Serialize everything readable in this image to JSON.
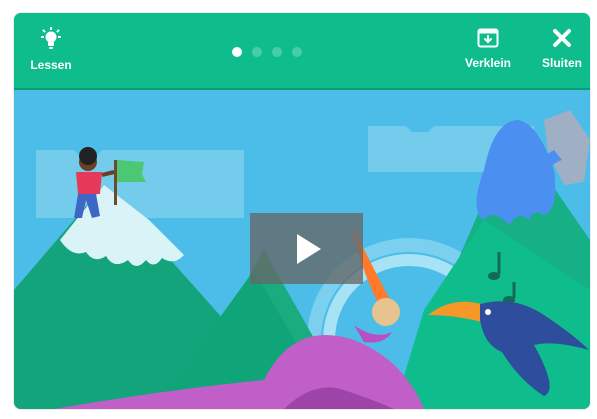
{
  "header": {
    "lessons_label": "Lessen",
    "shrink_label": "Verklein",
    "close_label": "Sluiten",
    "slides": [
      {
        "active": true
      },
      {
        "active": false
      },
      {
        "active": false
      },
      {
        "active": false
      }
    ]
  },
  "colors": {
    "header": "#0fbd8c",
    "sky": "#4cbde8",
    "mountain_green": "#14a37a",
    "snow": "#d9f3f7",
    "purple_paint": "#c15fc9",
    "blue_paint": "#4b8ff0"
  },
  "icons": {
    "lessons": "lightbulb-icon",
    "shrink": "window-shrink-icon",
    "close": "close-icon",
    "play": "play-icon"
  }
}
